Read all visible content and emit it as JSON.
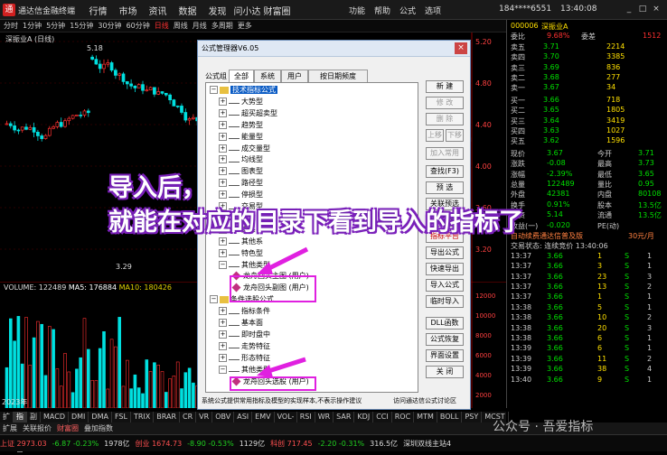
{
  "topbar": {
    "logo": "通",
    "title": "通达信金融终端",
    "menu": [
      "行情",
      "市场",
      "资讯",
      "数据",
      "发现",
      "问小达",
      "财富圈"
    ],
    "menu2": [
      "功能",
      "帮助",
      "公式",
      "选项"
    ],
    "account": "184****6551",
    "clock": "13:40:08"
  },
  "periodbar": {
    "items": [
      "分时",
      "1分钟",
      "5分钟",
      "15分钟",
      "30分钟",
      "60分钟",
      "日线",
      "周线",
      "月线",
      "多周期",
      "更多"
    ],
    "selected": 6
  },
  "chart": {
    "title": "深振业A (日线)",
    "price_high": "5.18",
    "price_low": "3.29",
    "year_label": "2023年",
    "axis_labels": [
      "5.20",
      "4.80",
      "4.40",
      "4.00",
      "3.60",
      "3.20"
    ]
  },
  "volume": {
    "label": "VOLUME: 122489",
    "ma5": "MA5: 176884",
    "ma10": "MA10: 180426",
    "axis_labels": [
      "12000",
      "10000",
      "8000",
      "6000",
      "4000",
      "2000"
    ]
  },
  "rightpanel": {
    "code": "000006",
    "name": "深振业A",
    "webi_label": "委比",
    "webi_value": "9.68%",
    "weicha_label": "委差",
    "weicha_value": "1512",
    "sells": [
      {
        "label": "卖五",
        "price": "3.71",
        "vol": "2214"
      },
      {
        "label": "卖四",
        "price": "3.70",
        "vol": "3385"
      },
      {
        "label": "卖三",
        "price": "3.69",
        "vol": "836"
      },
      {
        "label": "卖二",
        "price": "3.68",
        "vol": "277"
      },
      {
        "label": "卖一",
        "price": "3.67",
        "vol": "34"
      }
    ],
    "buys": [
      {
        "label": "买一",
        "price": "3.66",
        "vol": "718"
      },
      {
        "label": "买二",
        "price": "3.65",
        "vol": "1805"
      },
      {
        "label": "买三",
        "price": "3.64",
        "vol": "3419"
      },
      {
        "label": "买四",
        "price": "3.63",
        "vol": "1027"
      },
      {
        "label": "买五",
        "price": "3.62",
        "vol": "1596"
      }
    ],
    "stats": [
      {
        "l1": "现价",
        "v1": "3.67",
        "l2": "今开",
        "v2": "3.71"
      },
      {
        "l1": "涨跌",
        "v1": "-0.08",
        "l2": "最高",
        "v2": "3.73"
      },
      {
        "l1": "涨幅",
        "v1": "-2.39%",
        "l2": "最低",
        "v2": "3.65"
      },
      {
        "l1": "总量",
        "v1": "122489",
        "l2": "量比",
        "v2": "0.95"
      },
      {
        "l1": "外盘",
        "v1": "42381",
        "l2": "内盘",
        "v2": "80108"
      },
      {
        "l1": "换手",
        "v1": "0.91%",
        "l2": "股本",
        "v2": "13.5亿"
      },
      {
        "l1": "净资",
        "v1": "5.14",
        "l2": "流通",
        "v2": "13.5亿"
      },
      {
        "l1": "收益(一)",
        "v1": "-0.020",
        "l2": "PE(动)",
        "v2": ""
      }
    ],
    "promo": "自动续费通达信普及版",
    "promo_price": "30元/月",
    "trade_status": "交易状态: 连续竞价 13:40:06",
    "ticks": [
      {
        "t": "13:37",
        "p": "3.66",
        "v": "1",
        "s": "S",
        "c": "1"
      },
      {
        "t": "13:37",
        "p": "3.66",
        "v": "3",
        "s": "S",
        "c": "1"
      },
      {
        "t": "13:37",
        "p": "3.66",
        "v": "23",
        "s": "S",
        "c": "3"
      },
      {
        "t": "13:37",
        "p": "3.66",
        "v": "13",
        "s": "S",
        "c": "2"
      },
      {
        "t": "13:37",
        "p": "3.66",
        "v": "1",
        "s": "S",
        "c": "1"
      },
      {
        "t": "13:38",
        "p": "3.66",
        "v": "5",
        "s": "S",
        "c": "1"
      },
      {
        "t": "13:38",
        "p": "3.66",
        "v": "10",
        "s": "S",
        "c": "2"
      },
      {
        "t": "13:38",
        "p": "3.66",
        "v": "20",
        "s": "S",
        "c": "3"
      },
      {
        "t": "13:38",
        "p": "3.66",
        "v": "6",
        "s": "S",
        "c": "1"
      },
      {
        "t": "13:39",
        "p": "3.66",
        "v": "6",
        "s": "S",
        "c": "1"
      },
      {
        "t": "13:39",
        "p": "3.66",
        "v": "11",
        "s": "S",
        "c": "2"
      },
      {
        "t": "13:39",
        "p": "3.66",
        "v": "38",
        "s": "S",
        "c": "4"
      },
      {
        "t": "13:40",
        "p": "3.66",
        "v": "9",
        "s": "S",
        "c": "1"
      }
    ]
  },
  "dialog": {
    "title": "公式管理器V6.05",
    "group_label": "公式组",
    "tabs": [
      "全部",
      "系统",
      "用户",
      "按日期频度"
    ],
    "tree": [
      {
        "text": "技术指标公式",
        "level": 0,
        "kind": "fold",
        "sel": true
      },
      {
        "text": "大势型",
        "level": 1,
        "kind": "key"
      },
      {
        "text": "超买超卖型",
        "level": 1,
        "kind": "key"
      },
      {
        "text": "趋势型",
        "level": 1,
        "kind": "key"
      },
      {
        "text": "能量型",
        "level": 1,
        "kind": "key"
      },
      {
        "text": "成交量型",
        "level": 1,
        "kind": "key"
      },
      {
        "text": "均线型",
        "level": 1,
        "kind": "key"
      },
      {
        "text": "图表型",
        "level": 1,
        "kind": "key"
      },
      {
        "text": "路径型",
        "level": 1,
        "kind": "key"
      },
      {
        "text": "停损型",
        "level": 1,
        "kind": "key"
      },
      {
        "text": "交易型",
        "level": 1,
        "kind": "key"
      },
      {
        "text": "神系",
        "level": 1,
        "kind": "key"
      },
      {
        "text": "鬼系",
        "level": 1,
        "kind": "key"
      },
      {
        "text": "其他系",
        "level": 1,
        "kind": "key"
      },
      {
        "text": "特色型",
        "level": 1,
        "kind": "key"
      },
      {
        "text": "其他类型",
        "level": 1,
        "kind": "key",
        "open": true
      },
      {
        "text": "龙舟回头主图 (用户)",
        "level": 2,
        "kind": "dia"
      },
      {
        "text": "龙舟回头副图 (用户)",
        "level": 2,
        "kind": "dia"
      },
      {
        "text": "条件选股公式",
        "level": 0,
        "kind": "fold"
      },
      {
        "text": "指标条件",
        "level": 1,
        "kind": "key"
      },
      {
        "text": "基本面",
        "level": 1,
        "kind": "key"
      },
      {
        "text": "即时盘中",
        "level": 1,
        "kind": "key"
      },
      {
        "text": "走势特征",
        "level": 1,
        "kind": "key"
      },
      {
        "text": "形态特征",
        "level": 1,
        "kind": "key"
      },
      {
        "text": "其他类型",
        "level": 1,
        "kind": "key",
        "open": true
      },
      {
        "text": "龙舟回头选股 (用户)",
        "level": 2,
        "kind": "dia"
      }
    ],
    "buttons": [
      {
        "label": "新 建",
        "state": ""
      },
      {
        "label": "修 改",
        "state": "dis"
      },
      {
        "label": "删 除",
        "state": "dis"
      },
      {
        "label": "上移",
        "state": "dis"
      },
      {
        "label": "下移",
        "state": "dis"
      },
      {
        "label": "加入常用",
        "state": "dis"
      },
      {
        "label": "查找(F3)",
        "state": ""
      },
      {
        "label": "预 选",
        "state": ""
      },
      {
        "label": "关联预选",
        "state": ""
      },
      {
        "label": "同步与分享",
        "state": ""
      },
      {
        "label": "指标平台",
        "state": "red"
      },
      {
        "label": "导出公式",
        "state": ""
      },
      {
        "label": "快速导出",
        "state": ""
      },
      {
        "label": "导入公式",
        "state": ""
      },
      {
        "label": "临时导入",
        "state": ""
      },
      {
        "label": "DLL函数",
        "state": ""
      },
      {
        "label": "公式恢复",
        "state": ""
      },
      {
        "label": "界面设置",
        "state": ""
      },
      {
        "label": "关 闭",
        "state": ""
      }
    ],
    "footer": "系统公式提供常用指标及模型的实现样本,不表示操作建议",
    "footer_link": "访问通达信公式讨论区"
  },
  "annotation": {
    "line1": "导入后，",
    "line2": "就能在对应的目录下看到导入的指标了"
  },
  "tabbar": [
    "扩展",
    "指标平台",
    "副图",
    "MACD",
    "DMI",
    "DMA",
    "FSL",
    "TRIX",
    "BRAR",
    "CR",
    "VR",
    "OBV",
    "ASI",
    "EMV",
    "VOL-TDX",
    "RSI",
    "WR",
    "SAR",
    "KDJ",
    "CCI",
    "ROC",
    "MTM",
    "BOLL",
    "PSY",
    "MCST"
  ],
  "tabbar2": [
    "扩展",
    "关联报价",
    "财富圈",
    "叠加指数"
  ],
  "statusbar": {
    "items": [
      {
        "text": "上证 2973.03",
        "c": "#ff5050"
      },
      {
        "text": "-6.87 -0.23%",
        "c": "#20d020"
      },
      {
        "text": "1978亿",
        "c": "#ddd"
      },
      {
        "text": "创业 1674.73",
        "c": "#ff5050"
      },
      {
        "text": "-8.90 -0.53%",
        "c": "#20d020"
      },
      {
        "text": "1129亿",
        "c": "#ddd"
      },
      {
        "text": "科创 717.45",
        "c": "#ff5050"
      },
      {
        "text": "-2.20 -0.31%",
        "c": "#20d020"
      },
      {
        "text": "316.5亿",
        "c": "#ddd"
      },
      {
        "text": "深圳双线主站4",
        "c": "#ddd"
      }
    ],
    "watermark": "公众号 · 吾爱指标"
  }
}
